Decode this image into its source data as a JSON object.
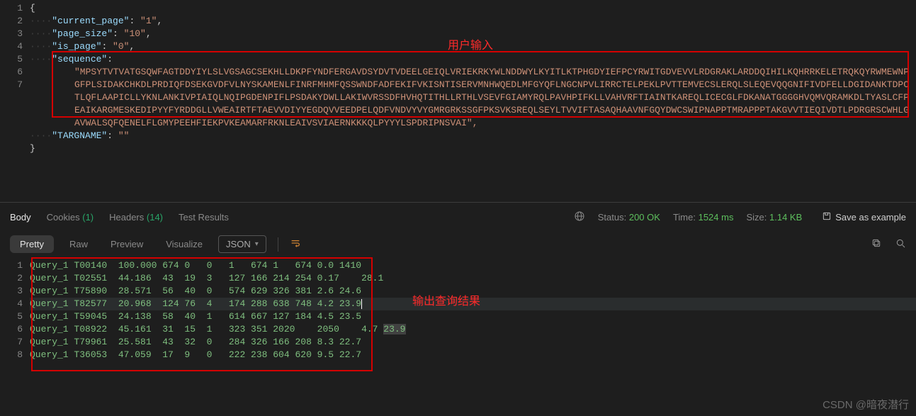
{
  "annotations": {
    "user_input": "用户输入",
    "output_result": "输出查询结果"
  },
  "request_json": {
    "lines": [
      {
        "num": 1,
        "text": "{"
      },
      {
        "num": 2,
        "key": "current_page",
        "val": "1"
      },
      {
        "num": 3,
        "key": "page_size",
        "val": "10"
      },
      {
        "num": 4,
        "key": "is_page",
        "val": "0"
      },
      {
        "num": 5,
        "key": "sequence",
        "seq": true
      },
      {
        "num": 6,
        "key": "TARGNAME",
        "val": ""
      },
      {
        "num": 7,
        "text": "}"
      }
    ],
    "sequence_value": "MPSYTVTVATGSQWFAGTDDYIYLSLVGSAGCSEKHLLDKPFYNDFERGAVDSYDVTVDEELGEIQLVRIEKRKYWLNDDWYLKYITLKTPHGDYIEFPCYRWITGDVEVVLRDGRAKLARDDQIHILKQHRRKELETRQKQYRWMEWNPGFPLSIDAKCHKDLPRDIQFDSEKGVDFVLNYSKAMENLFINRFMHMFQSSWNDFADFEKIFVKISNTISERVMNHWQEDLMFGYQFLNGCNPVLIRRCTELPEKLPVTTEMVECSLERQLSLEQEVQQGNIFIVDFELLDGIDANKTDPCTLQFLAAPICLLYKNLANKIVPIAIQLNQIPGDENPIFLPSDAKYDWLLAKIWVRSSDFHVHQTITHLLRTHLVSEVFGIAMYRQLPAVHPIFKLLVAHVRFTIAINTKAREQLICECGLFDKANATGGGGHVQMVQRAMKDLTYASLCFPEAIKARGMESKEDIPYYFYRDDGLLVWEAIRTFTAEVVDIYYEGDQVVEEDPELQDFVNDVYVYGMRGRKSSGFPKSVKSREQLSEYLTVVIFTASAQHAAVNFGQYDWCSWIPNAPPTMRAPPPTAKGVVTIEQIVDTLPDRGRSCWHLGAVWALSQFQENELFLGMYPEEHFIEKPVKEAMARFRKNLEAIVSVIAERNKKKQLPYYYLSPDRIPNSVAI"
  },
  "response_tabs": {
    "body": "Body",
    "cookies": "Cookies",
    "cookies_count": "(1)",
    "headers": "Headers",
    "headers_count": "(14)",
    "test_results": "Test Results"
  },
  "status_bar": {
    "status_label": "Status:",
    "status_value": "200 OK",
    "time_label": "Time:",
    "time_value": "1524 ms",
    "size_label": "Size:",
    "size_value": "1.14 KB",
    "save_as": "Save as example"
  },
  "view_toolbar": {
    "pretty": "Pretty",
    "raw": "Raw",
    "preview": "Preview",
    "visualize": "Visualize",
    "format": "JSON"
  },
  "results": {
    "highlight_index": 3,
    "rows": [
      "Query_1 T00140  100.000 674 0   0   1   674 1   674 0.0 1410",
      "Query_1 T02551  44.186  43  19  3   127 166 214 254 0.17    28.1",
      "Query_1 T75890  28.571  56  40  0   574 629 326 381 2.6 24.6",
      "Query_1 T82577  20.968  124 76  4   174 288 638 748 4.2 23.9",
      "Query_1 T59045  24.138  58  40  1   614 667 127 184 4.5 23.5",
      "Query_1 T08922  45.161  31  15  1   323 351 2020    2050    4.7 23.9",
      "Query_1 T79961  25.581  43  32  0   284 326 166 208 8.3 22.7",
      "Query_1 T36053  47.059  17  9   0   222 238 604 620 9.5 22.7"
    ]
  },
  "watermark": "CSDN @暗夜潜行"
}
